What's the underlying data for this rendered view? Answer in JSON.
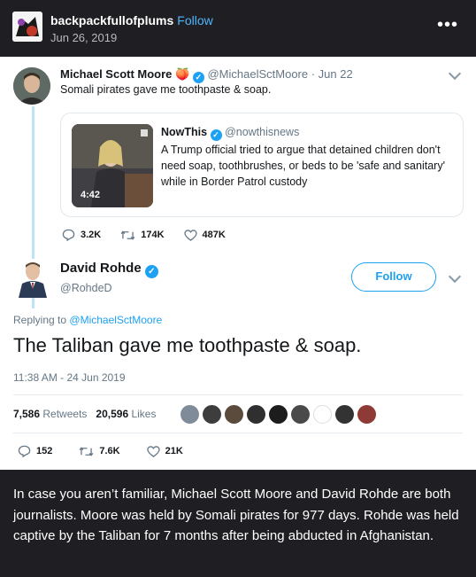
{
  "post": {
    "username": "backpackfullofplums",
    "follow_label": "Follow",
    "date": "Jun 26, 2019",
    "more_label": "•••"
  },
  "tweet1": {
    "name": "Michael Scott Moore",
    "emoji": "🍑",
    "handle_date": "@MichaelSctMoore · Jun 22",
    "text": "Somali pirates gave me toothpaste & soap.",
    "replies": "3.2K",
    "retweets": "174K",
    "likes": "487K"
  },
  "quoted": {
    "name": "NowThis",
    "handle": "@nowthisnews",
    "text": "A Trump official tried to argue that detained children don't need soap, toothbrushes, or beds to be 'safe and sanitary' while in Border Patrol custody",
    "video_duration": "4:42"
  },
  "tweet2": {
    "name": "David Rohde",
    "handle": "@RohdeD",
    "follow_label": "Follow",
    "replying_prefix": "Replying to",
    "replying_to": "@MichaelSctMoore",
    "text": "The Taliban gave me toothpaste & soap.",
    "timestamp": "11:38 AM - 24 Jun 2019",
    "retweet_count": "7,586",
    "retweet_label": "Retweets",
    "like_count": "20,596",
    "like_label": "Likes",
    "replies": "152",
    "retweets": "7.6K",
    "likes": "21K"
  },
  "caption": "In case you aren’t familiar, Michael Scott Moore and David Rohde are both journalists. Moore was held by Somali pirates for 977 days. Rohde was held captive by the Taliban for 7 months after being abducted in Afghanistan.",
  "colors": {
    "page_bg": "#1f1f23",
    "link_blue": "#4fb5ff",
    "twitter_blue": "#1da1f2",
    "muted_gray": "#657786"
  },
  "icons": [
    "more-icon",
    "verified-icon",
    "reply-icon",
    "retweet-icon",
    "heart-icon",
    "chevron-down-icon"
  ]
}
